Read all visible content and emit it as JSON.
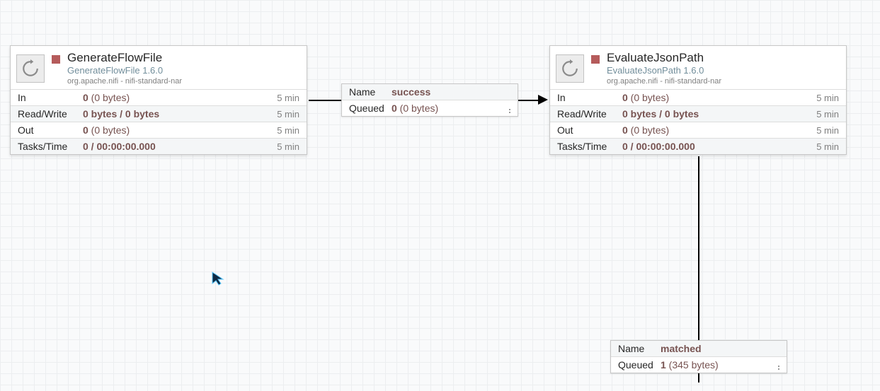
{
  "processors": [
    {
      "name": "GenerateFlowFile",
      "type": "GenerateFlowFile 1.6.0",
      "bundle": "org.apache.nifi - nifi-standard-nar",
      "stats": {
        "in_label": "In",
        "in_bold": "0",
        "in_rest": " (0 bytes)",
        "in_period": "5 min",
        "rw_label": "Read/Write",
        "rw_bold": "0 bytes / 0 bytes",
        "rw_rest": "",
        "rw_period": "5 min",
        "out_label": "Out",
        "out_bold": "0",
        "out_rest": " (0 bytes)",
        "out_period": "5 min",
        "tt_label": "Tasks/Time",
        "tt_bold": "0 / 00:00:00.000",
        "tt_rest": "",
        "tt_period": "5 min"
      }
    },
    {
      "name": "EvaluateJsonPath",
      "type": "EvaluateJsonPath 1.6.0",
      "bundle": "org.apache.nifi - nifi-standard-nar",
      "stats": {
        "in_label": "In",
        "in_bold": "0",
        "in_rest": " (0 bytes)",
        "in_period": "5 min",
        "rw_label": "Read/Write",
        "rw_bold": "0 bytes / 0 bytes",
        "rw_rest": "",
        "rw_period": "5 min",
        "out_label": "Out",
        "out_bold": "0",
        "out_rest": " (0 bytes)",
        "out_period": "5 min",
        "tt_label": "Tasks/Time",
        "tt_bold": "0 / 00:00:00.000",
        "tt_rest": "",
        "tt_period": "5 min"
      }
    }
  ],
  "connections": [
    {
      "name_label": "Name",
      "name_value": "success",
      "queued_label": "Queued",
      "queued_bold": "0",
      "queued_rest": " (0 bytes)"
    },
    {
      "name_label": "Name",
      "name_value": "matched",
      "queued_label": "Queued",
      "queued_bold": "1",
      "queued_rest": " (345 bytes)"
    }
  ]
}
